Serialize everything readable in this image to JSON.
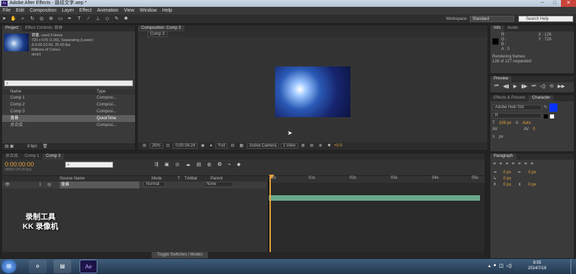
{
  "window": {
    "title": "Adobe After Effects - 路径文字.aep *",
    "ae_glyph": "Ae",
    "min": "─",
    "max": "□",
    "close": "✕"
  },
  "menu": [
    "File",
    "Edit",
    "Composition",
    "Layer",
    "Effect",
    "Animation",
    "View",
    "Window",
    "Help"
  ],
  "toolbar": {
    "workspace_label": "Workspace:",
    "workspace_value": "Standard",
    "search_placeholder": "Search Help"
  },
  "project": {
    "tabs": [
      "Project",
      "Effect Controls: 背景"
    ],
    "item_name": "背景",
    "item_used": ", used 3 times",
    "info1": "720 x 576 (1.09), Separating (Lower)",
    "info2": "Δ 0;00:10:00, 25.00 fps",
    "info3": "Millions of Colors",
    "info4": "dmb1",
    "col_name": "Name",
    "col_type": "Type",
    "rows": [
      {
        "name": "Comp 1",
        "type": "Composi..."
      },
      {
        "name": "Comp 2",
        "type": "Composi..."
      },
      {
        "name": "Comp 3",
        "type": "Composi..."
      },
      {
        "name": "背景",
        "type": "QuickTime"
      },
      {
        "name": "总合成",
        "type": "Composi..."
      }
    ],
    "bpc": "8 bpc"
  },
  "comp": {
    "tab": "Composition: Comp 3",
    "subtab": "Comp 3",
    "zoom": "25%",
    "timecode": "0;00:04:24",
    "res": "Full",
    "camera": "Active Camera",
    "view": "1 View",
    "exposure": "+0.0"
  },
  "info": {
    "tabs": [
      "Info",
      "Audio"
    ],
    "r": "R :",
    "g": "G :",
    "b": "B :",
    "a": "A : 0",
    "x": "X : 126",
    "y": "Y : 726",
    "status1": "Rendering frames",
    "status2": "126 of 127 requested"
  },
  "preview": {
    "tab": "Preview"
  },
  "character": {
    "tabs": [
      "Effects & Presets",
      "Character"
    ],
    "font": "Adobe Heiti Std",
    "style": "R",
    "size": "106 px",
    "leading": "Auto",
    "tracking": "0",
    "unit": "px"
  },
  "paragraph": {
    "tab": "Paragraph",
    "v1": "0 px",
    "v2": "0 px",
    "v3": "0 px",
    "v4": "0 px",
    "v5": "0 px"
  },
  "timeline": {
    "tabs": [
      "总合成",
      "Comp 1",
      "Comp 3"
    ],
    "timecode": "0:00:00:00",
    "frames": "00000 (25.00 fps)",
    "col_source": "Source Name",
    "col_mode": "Mode",
    "col_t": "T",
    "col_trkmat": "TrkMat",
    "col_parent": "Parent",
    "layer_num": "1",
    "layer_name": "背景",
    "layer_mode": "Normal",
    "layer_parent": "None",
    "toggle": "Toggle Switches / Modes",
    "ruler": [
      "0s",
      "01s",
      "02s",
      "03s",
      "04s",
      "05s"
    ]
  },
  "watermark": {
    "line1": "录制工具",
    "line2": "KK 录像机"
  },
  "taskbar": {
    "time": "8:55",
    "date": "2014/7/18",
    "ae_button": "Ae"
  }
}
